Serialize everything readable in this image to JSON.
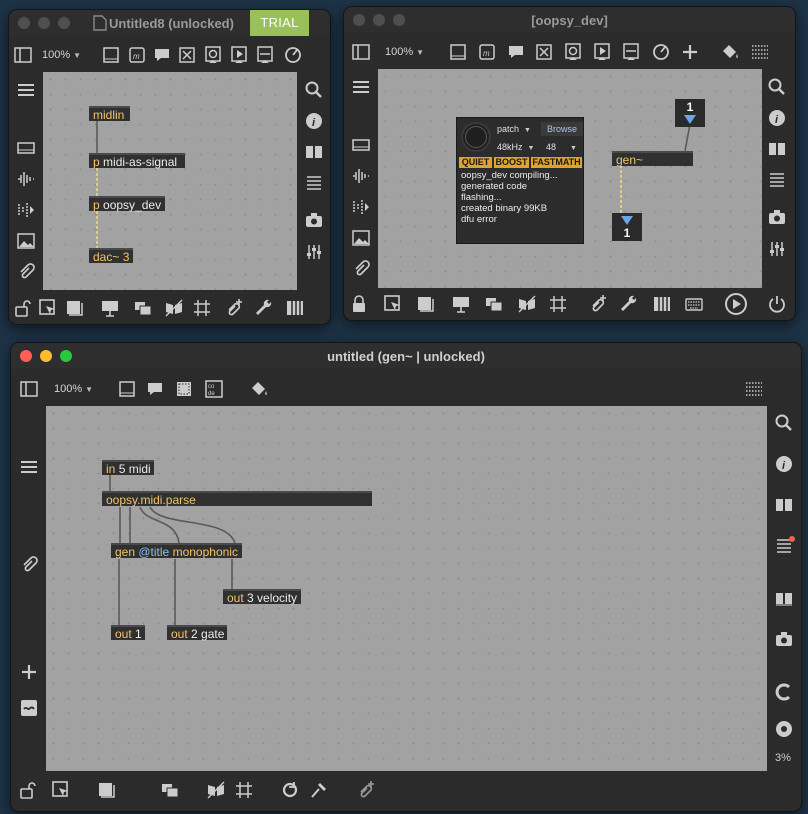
{
  "windows": {
    "untitled8": {
      "title": "Untitled8 (unlocked)",
      "trial_badge": "TRIAL",
      "zoom": "100%",
      "objects": {
        "midlin": {
          "text": "midlin"
        },
        "midi_as_signal": {
          "prefix": "p",
          "text": "midi-as-signal"
        },
        "oopsy_dev": {
          "prefix": "p",
          "text": "oopsy_dev"
        },
        "dac": {
          "text": "dac~ 3"
        }
      }
    },
    "oopsy_dev": {
      "title": "[oopsy_dev]",
      "zoom": "100%",
      "panel": {
        "target_select": "patch",
        "browse_label": "Browse",
        "samplerate_select": "48kHz",
        "blocksize_select": "48",
        "flags": [
          "QUIET",
          "BOOST",
          "FASTMATH"
        ],
        "console_lines": [
          "oopsy_dev compiling...",
          "generated code",
          "flashing...",
          "created binary 99KB",
          "dfu error"
        ]
      },
      "inlet_number": "1",
      "gen_object": "gen~",
      "outlet_number": "1"
    },
    "gen_patcher": {
      "title": "untitled (gen~ | unlocked)",
      "zoom": "100%",
      "zoom_percent": "3%",
      "objects": {
        "in5": {
          "keyword": "in",
          "text": "5 midi"
        },
        "oopsy_parse": {
          "text": "oopsy.midi.parse"
        },
        "gen_mono": {
          "keyword": "gen",
          "attr": "@title",
          "text": "monophonic"
        },
        "out3": {
          "keyword": "out",
          "text": "3 velocity"
        },
        "out1": {
          "keyword": "out",
          "text": "1"
        },
        "out2": {
          "keyword": "out",
          "text": "2 gate"
        }
      }
    }
  },
  "colors": {
    "desktop": "#1d3346",
    "canvas": "#a2a2a2",
    "object_box": "#303030",
    "accent_orange": "#e0a32b",
    "trial_green": "#9ac05a",
    "number_arrow": "#6aa6e6",
    "signal_patchcord": "#d7d37a",
    "message_patchcord": "#5a5a5a"
  },
  "icons": [
    "sidebar-icon",
    "presentation-icon",
    "bpatcher-icon",
    "comment-icon",
    "toggle-icon",
    "button-icon",
    "play-icon",
    "slider-icon",
    "dial-icon",
    "plus-icon",
    "paint-bucket-icon",
    "grid-icon",
    "search-icon",
    "info-icon",
    "book-icon",
    "list-icon",
    "snapshot-icon",
    "mixer-icon",
    "paperclip-icon",
    "lock-icon",
    "cursor-icon",
    "window-icon",
    "hide-icon",
    "wrench-icon",
    "keyboard-icon",
    "power-icon",
    "refresh-icon",
    "hammer-icon"
  ]
}
